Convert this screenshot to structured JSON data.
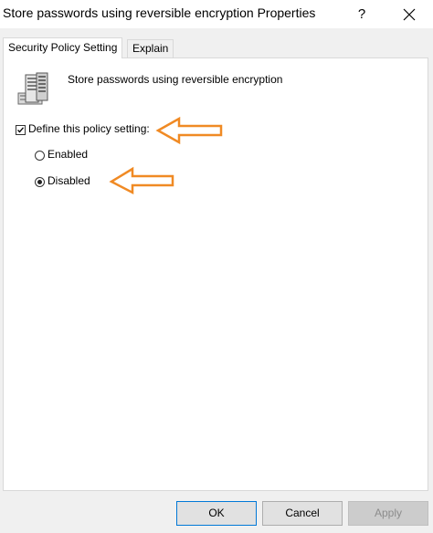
{
  "window": {
    "title": "Store passwords using reversible encryption Properties",
    "help_label": "?"
  },
  "tabs": [
    {
      "label": "Security Policy Setting",
      "active": true
    },
    {
      "label": "Explain",
      "active": false
    }
  ],
  "policy": {
    "icon": "server-policy-icon",
    "name": "Store passwords using reversible encryption"
  },
  "define_setting": {
    "label": "Define this policy setting:",
    "checked": true
  },
  "options": [
    {
      "label": "Enabled",
      "selected": false
    },
    {
      "label": "Disabled",
      "selected": true
    }
  ],
  "annotations": {
    "arrow_color": "#f08a24",
    "arrow_icon": "left-arrow-icon"
  },
  "buttons": {
    "ok": "OK",
    "cancel": "Cancel",
    "apply": "Apply",
    "apply_enabled": false
  },
  "colors": {
    "focus_border": "#0078d7",
    "panel_bg": "#ffffff",
    "dialog_bg": "#f0f0f0"
  }
}
